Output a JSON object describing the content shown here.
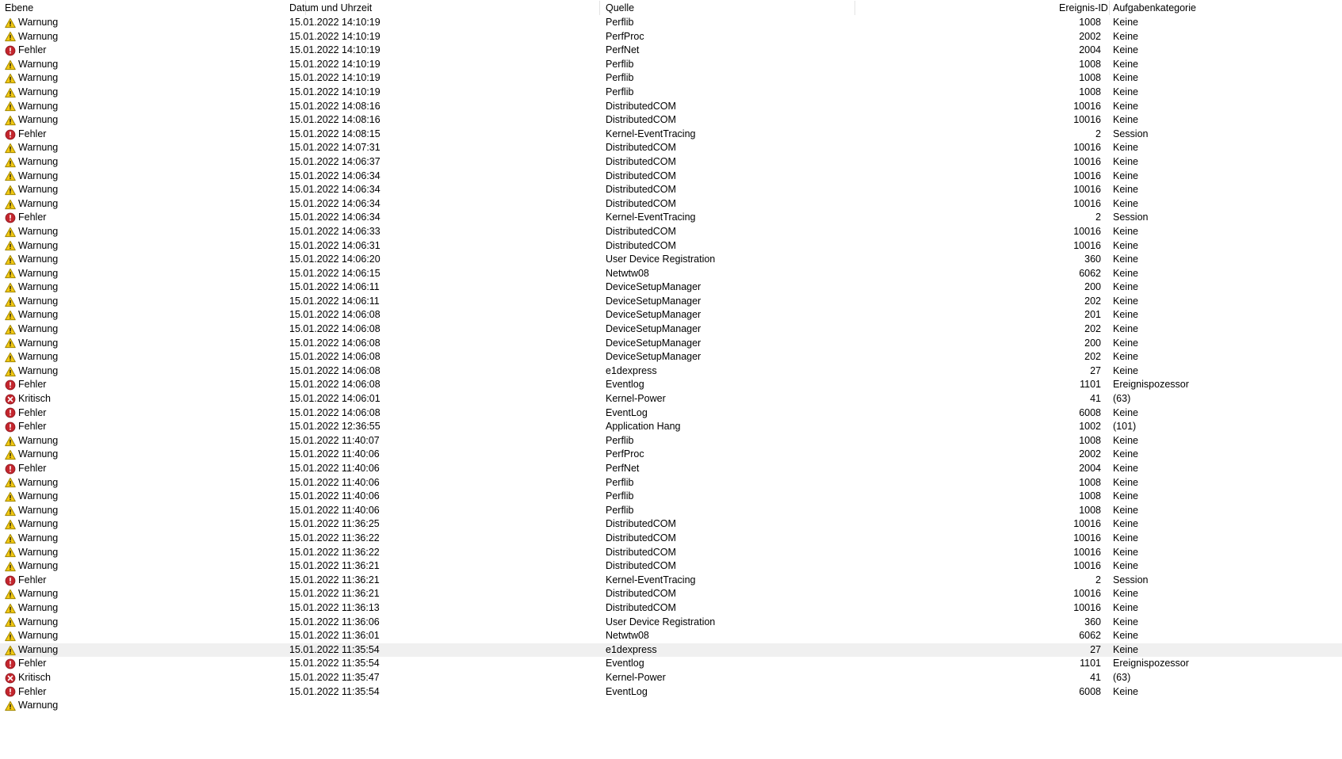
{
  "window": {
    "app": "Ereignisanzeige",
    "locale": "de-DE"
  },
  "colors": {
    "warning": "#f2c811",
    "warning_border": "#a08500",
    "error": "#c4262e",
    "critical": "#c4262e",
    "selected_row_bg": "#f0f0f0",
    "header_separator": "#e3e3e3",
    "text": "#000000",
    "background": "#ffffff"
  },
  "table": {
    "columns": [
      {
        "key": "level",
        "label": "Ebene",
        "align": "left"
      },
      {
        "key": "datetime",
        "label": "Datum und Uhrzeit",
        "align": "left"
      },
      {
        "key": "source",
        "label": "Quelle",
        "align": "left"
      },
      {
        "key": "event_id",
        "label": "Ereignis-ID",
        "align": "right"
      },
      {
        "key": "task_category",
        "label": "Aufgabenkategorie",
        "align": "left"
      }
    ],
    "rows": [
      {
        "level": "Warnung",
        "icon": "warning-icon",
        "datetime": "15.01.2022 14:10:19",
        "source": "Perflib",
        "event_id": "1008",
        "task_category": "Keine",
        "selected": false
      },
      {
        "level": "Warnung",
        "icon": "warning-icon",
        "datetime": "15.01.2022 14:10:19",
        "source": "PerfProc",
        "event_id": "2002",
        "task_category": "Keine",
        "selected": false
      },
      {
        "level": "Fehler",
        "icon": "error-icon",
        "datetime": "15.01.2022 14:10:19",
        "source": "PerfNet",
        "event_id": "2004",
        "task_category": "Keine",
        "selected": false
      },
      {
        "level": "Warnung",
        "icon": "warning-icon",
        "datetime": "15.01.2022 14:10:19",
        "source": "Perflib",
        "event_id": "1008",
        "task_category": "Keine",
        "selected": false
      },
      {
        "level": "Warnung",
        "icon": "warning-icon",
        "datetime": "15.01.2022 14:10:19",
        "source": "Perflib",
        "event_id": "1008",
        "task_category": "Keine",
        "selected": false
      },
      {
        "level": "Warnung",
        "icon": "warning-icon",
        "datetime": "15.01.2022 14:10:19",
        "source": "Perflib",
        "event_id": "1008",
        "task_category": "Keine",
        "selected": false
      },
      {
        "level": "Warnung",
        "icon": "warning-icon",
        "datetime": "15.01.2022 14:08:16",
        "source": "DistributedCOM",
        "event_id": "10016",
        "task_category": "Keine",
        "selected": false
      },
      {
        "level": "Warnung",
        "icon": "warning-icon",
        "datetime": "15.01.2022 14:08:16",
        "source": "DistributedCOM",
        "event_id": "10016",
        "task_category": "Keine",
        "selected": false
      },
      {
        "level": "Fehler",
        "icon": "error-icon",
        "datetime": "15.01.2022 14:08:15",
        "source": "Kernel-EventTracing",
        "event_id": "2",
        "task_category": "Session",
        "selected": false
      },
      {
        "level": "Warnung",
        "icon": "warning-icon",
        "datetime": "15.01.2022 14:07:31",
        "source": "DistributedCOM",
        "event_id": "10016",
        "task_category": "Keine",
        "selected": false
      },
      {
        "level": "Warnung",
        "icon": "warning-icon",
        "datetime": "15.01.2022 14:06:37",
        "source": "DistributedCOM",
        "event_id": "10016",
        "task_category": "Keine",
        "selected": false
      },
      {
        "level": "Warnung",
        "icon": "warning-icon",
        "datetime": "15.01.2022 14:06:34",
        "source": "DistributedCOM",
        "event_id": "10016",
        "task_category": "Keine",
        "selected": false
      },
      {
        "level": "Warnung",
        "icon": "warning-icon",
        "datetime": "15.01.2022 14:06:34",
        "source": "DistributedCOM",
        "event_id": "10016",
        "task_category": "Keine",
        "selected": false
      },
      {
        "level": "Warnung",
        "icon": "warning-icon",
        "datetime": "15.01.2022 14:06:34",
        "source": "DistributedCOM",
        "event_id": "10016",
        "task_category": "Keine",
        "selected": false
      },
      {
        "level": "Fehler",
        "icon": "error-icon",
        "datetime": "15.01.2022 14:06:34",
        "source": "Kernel-EventTracing",
        "event_id": "2",
        "task_category": "Session",
        "selected": false
      },
      {
        "level": "Warnung",
        "icon": "warning-icon",
        "datetime": "15.01.2022 14:06:33",
        "source": "DistributedCOM",
        "event_id": "10016",
        "task_category": "Keine",
        "selected": false
      },
      {
        "level": "Warnung",
        "icon": "warning-icon",
        "datetime": "15.01.2022 14:06:31",
        "source": "DistributedCOM",
        "event_id": "10016",
        "task_category": "Keine",
        "selected": false
      },
      {
        "level": "Warnung",
        "icon": "warning-icon",
        "datetime": "15.01.2022 14:06:20",
        "source": "User Device Registration",
        "event_id": "360",
        "task_category": "Keine",
        "selected": false
      },
      {
        "level": "Warnung",
        "icon": "warning-icon",
        "datetime": "15.01.2022 14:06:15",
        "source": "Netwtw08",
        "event_id": "6062",
        "task_category": "Keine",
        "selected": false
      },
      {
        "level": "Warnung",
        "icon": "warning-icon",
        "datetime": "15.01.2022 14:06:11",
        "source": "DeviceSetupManager",
        "event_id": "200",
        "task_category": "Keine",
        "selected": false
      },
      {
        "level": "Warnung",
        "icon": "warning-icon",
        "datetime": "15.01.2022 14:06:11",
        "source": "DeviceSetupManager",
        "event_id": "202",
        "task_category": "Keine",
        "selected": false
      },
      {
        "level": "Warnung",
        "icon": "warning-icon",
        "datetime": "15.01.2022 14:06:08",
        "source": "DeviceSetupManager",
        "event_id": "201",
        "task_category": "Keine",
        "selected": false
      },
      {
        "level": "Warnung",
        "icon": "warning-icon",
        "datetime": "15.01.2022 14:06:08",
        "source": "DeviceSetupManager",
        "event_id": "202",
        "task_category": "Keine",
        "selected": false
      },
      {
        "level": "Warnung",
        "icon": "warning-icon",
        "datetime": "15.01.2022 14:06:08",
        "source": "DeviceSetupManager",
        "event_id": "200",
        "task_category": "Keine",
        "selected": false
      },
      {
        "level": "Warnung",
        "icon": "warning-icon",
        "datetime": "15.01.2022 14:06:08",
        "source": "DeviceSetupManager",
        "event_id": "202",
        "task_category": "Keine",
        "selected": false
      },
      {
        "level": "Warnung",
        "icon": "warning-icon",
        "datetime": "15.01.2022 14:06:08",
        "source": "e1dexpress",
        "event_id": "27",
        "task_category": "Keine",
        "selected": false
      },
      {
        "level": "Fehler",
        "icon": "error-icon",
        "datetime": "15.01.2022 14:06:08",
        "source": "Eventlog",
        "event_id": "1101",
        "task_category": "Ereignispozessor",
        "selected": false
      },
      {
        "level": "Kritisch",
        "icon": "critical-icon",
        "datetime": "15.01.2022 14:06:01",
        "source": "Kernel-Power",
        "event_id": "41",
        "task_category": "(63)",
        "selected": false
      },
      {
        "level": "Fehler",
        "icon": "error-icon",
        "datetime": "15.01.2022 14:06:08",
        "source": "EventLog",
        "event_id": "6008",
        "task_category": "Keine",
        "selected": false
      },
      {
        "level": "Fehler",
        "icon": "error-icon",
        "datetime": "15.01.2022 12:36:55",
        "source": "Application Hang",
        "event_id": "1002",
        "task_category": "(101)",
        "selected": false
      },
      {
        "level": "Warnung",
        "icon": "warning-icon",
        "datetime": "15.01.2022 11:40:07",
        "source": "Perflib",
        "event_id": "1008",
        "task_category": "Keine",
        "selected": false
      },
      {
        "level": "Warnung",
        "icon": "warning-icon",
        "datetime": "15.01.2022 11:40:06",
        "source": "PerfProc",
        "event_id": "2002",
        "task_category": "Keine",
        "selected": false
      },
      {
        "level": "Fehler",
        "icon": "error-icon",
        "datetime": "15.01.2022 11:40:06",
        "source": "PerfNet",
        "event_id": "2004",
        "task_category": "Keine",
        "selected": false
      },
      {
        "level": "Warnung",
        "icon": "warning-icon",
        "datetime": "15.01.2022 11:40:06",
        "source": "Perflib",
        "event_id": "1008",
        "task_category": "Keine",
        "selected": false
      },
      {
        "level": "Warnung",
        "icon": "warning-icon",
        "datetime": "15.01.2022 11:40:06",
        "source": "Perflib",
        "event_id": "1008",
        "task_category": "Keine",
        "selected": false
      },
      {
        "level": "Warnung",
        "icon": "warning-icon",
        "datetime": "15.01.2022 11:40:06",
        "source": "Perflib",
        "event_id": "1008",
        "task_category": "Keine",
        "selected": false
      },
      {
        "level": "Warnung",
        "icon": "warning-icon",
        "datetime": "15.01.2022 11:36:25",
        "source": "DistributedCOM",
        "event_id": "10016",
        "task_category": "Keine",
        "selected": false
      },
      {
        "level": "Warnung",
        "icon": "warning-icon",
        "datetime": "15.01.2022 11:36:22",
        "source": "DistributedCOM",
        "event_id": "10016",
        "task_category": "Keine",
        "selected": false
      },
      {
        "level": "Warnung",
        "icon": "warning-icon",
        "datetime": "15.01.2022 11:36:22",
        "source": "DistributedCOM",
        "event_id": "10016",
        "task_category": "Keine",
        "selected": false
      },
      {
        "level": "Warnung",
        "icon": "warning-icon",
        "datetime": "15.01.2022 11:36:21",
        "source": "DistributedCOM",
        "event_id": "10016",
        "task_category": "Keine",
        "selected": false
      },
      {
        "level": "Fehler",
        "icon": "error-icon",
        "datetime": "15.01.2022 11:36:21",
        "source": "Kernel-EventTracing",
        "event_id": "2",
        "task_category": "Session",
        "selected": false
      },
      {
        "level": "Warnung",
        "icon": "warning-icon",
        "datetime": "15.01.2022 11:36:21",
        "source": "DistributedCOM",
        "event_id": "10016",
        "task_category": "Keine",
        "selected": false
      },
      {
        "level": "Warnung",
        "icon": "warning-icon",
        "datetime": "15.01.2022 11:36:13",
        "source": "DistributedCOM",
        "event_id": "10016",
        "task_category": "Keine",
        "selected": false
      },
      {
        "level": "Warnung",
        "icon": "warning-icon",
        "datetime": "15.01.2022 11:36:06",
        "source": "User Device Registration",
        "event_id": "360",
        "task_category": "Keine",
        "selected": false
      },
      {
        "level": "Warnung",
        "icon": "warning-icon",
        "datetime": "15.01.2022 11:36:01",
        "source": "Netwtw08",
        "event_id": "6062",
        "task_category": "Keine",
        "selected": false
      },
      {
        "level": "Warnung",
        "icon": "warning-icon",
        "datetime": "15.01.2022 11:35:54",
        "source": "e1dexpress",
        "event_id": "27",
        "task_category": "Keine",
        "selected": true
      },
      {
        "level": "Fehler",
        "icon": "error-icon",
        "datetime": "15.01.2022 11:35:54",
        "source": "Eventlog",
        "event_id": "1101",
        "task_category": "Ereignispozessor",
        "selected": false
      },
      {
        "level": "Kritisch",
        "icon": "critical-icon",
        "datetime": "15.01.2022 11:35:47",
        "source": "Kernel-Power",
        "event_id": "41",
        "task_category": "(63)",
        "selected": false
      },
      {
        "level": "Fehler",
        "icon": "error-icon",
        "datetime": "15.01.2022 11:35:54",
        "source": "EventLog",
        "event_id": "6008",
        "task_category": "Keine",
        "selected": false
      },
      {
        "level": "Warnung",
        "icon": "warning-icon",
        "datetime": "",
        "source": "",
        "event_id": "",
        "task_category": "",
        "selected": false
      }
    ]
  }
}
